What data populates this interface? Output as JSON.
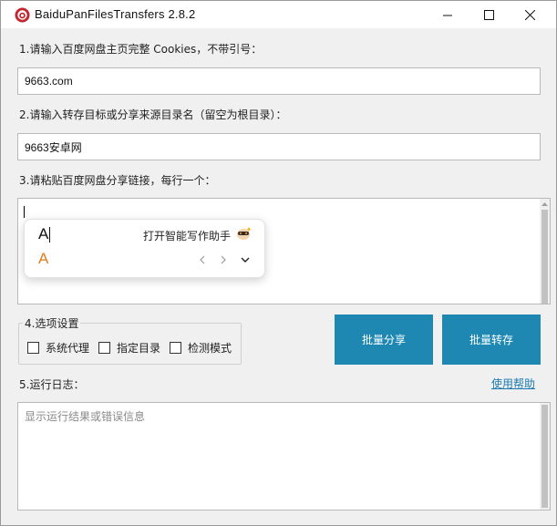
{
  "window": {
    "title": "BaiduPanFilesTransfers 2.8.2",
    "icon": "baidupan-app-icon",
    "controls": [
      "minimize-icon",
      "maximize-icon",
      "close-icon"
    ]
  },
  "cookies": {
    "label": "1.请输入百度网盘主页完整 Cookies，不带引号：",
    "value": "9663.com"
  },
  "target_dir": {
    "label": "2.请输入转存目标或分享来源目录名（留空为根目录）：",
    "value": "9663安卓网"
  },
  "links": {
    "label": "3.请粘贴百度网盘分享链接，每行一个：",
    "value": ""
  },
  "ime": {
    "candidate": "A",
    "candidate_alt": "A",
    "assistant": "打开智能写作助手",
    "icons": [
      "prev-icon",
      "next-icon",
      "expand-icon",
      "assistant-icon"
    ]
  },
  "options": {
    "legend": "4.选项设置",
    "items": [
      {
        "label": "系统代理",
        "checked": false
      },
      {
        "label": "指定目录",
        "checked": false
      },
      {
        "label": "检测模式",
        "checked": false
      }
    ]
  },
  "buttons": {
    "share": "批量分享",
    "transfer": "批量转存"
  },
  "log": {
    "label": "5.运行日志：",
    "help": "使用帮助",
    "placeholder": "显示运行结果或错误信息"
  },
  "colors": {
    "accent": "#1e88b3",
    "link": "#1b7bb0",
    "ime_orange": "#e07c1e"
  }
}
